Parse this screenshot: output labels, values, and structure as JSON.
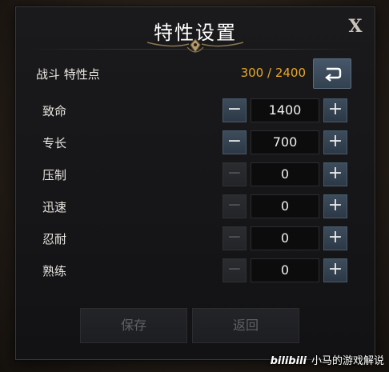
{
  "dialog": {
    "title": "特性设置",
    "close_label": "X"
  },
  "points": {
    "label": "战斗 特性点",
    "value": "300 / 2400"
  },
  "reset_icon": "return-arrow-icon",
  "stats": [
    {
      "label": "致命",
      "value": "1400",
      "minus": "−",
      "plus": "+",
      "minus_enabled": true
    },
    {
      "label": "专长",
      "value": "700",
      "minus": "−",
      "plus": "+",
      "minus_enabled": true
    },
    {
      "label": "压制",
      "value": "0",
      "minus": "−",
      "plus": "+",
      "minus_enabled": false
    },
    {
      "label": "迅速",
      "value": "0",
      "minus": "−",
      "plus": "+",
      "minus_enabled": false
    },
    {
      "label": "忍耐",
      "value": "0",
      "minus": "−",
      "plus": "+",
      "minus_enabled": false
    },
    {
      "label": "熟练",
      "value": "0",
      "minus": "−",
      "plus": "+",
      "minus_enabled": false
    }
  ],
  "footer": {
    "save_label": "保存",
    "back_label": "返回"
  },
  "watermark": {
    "logo": "bilibili",
    "text": "小马的游戏解说"
  },
  "colors": {
    "points_value": "#e7a62a",
    "button_active": "#3d4c5c",
    "button_disabled": "#2a2c30"
  }
}
